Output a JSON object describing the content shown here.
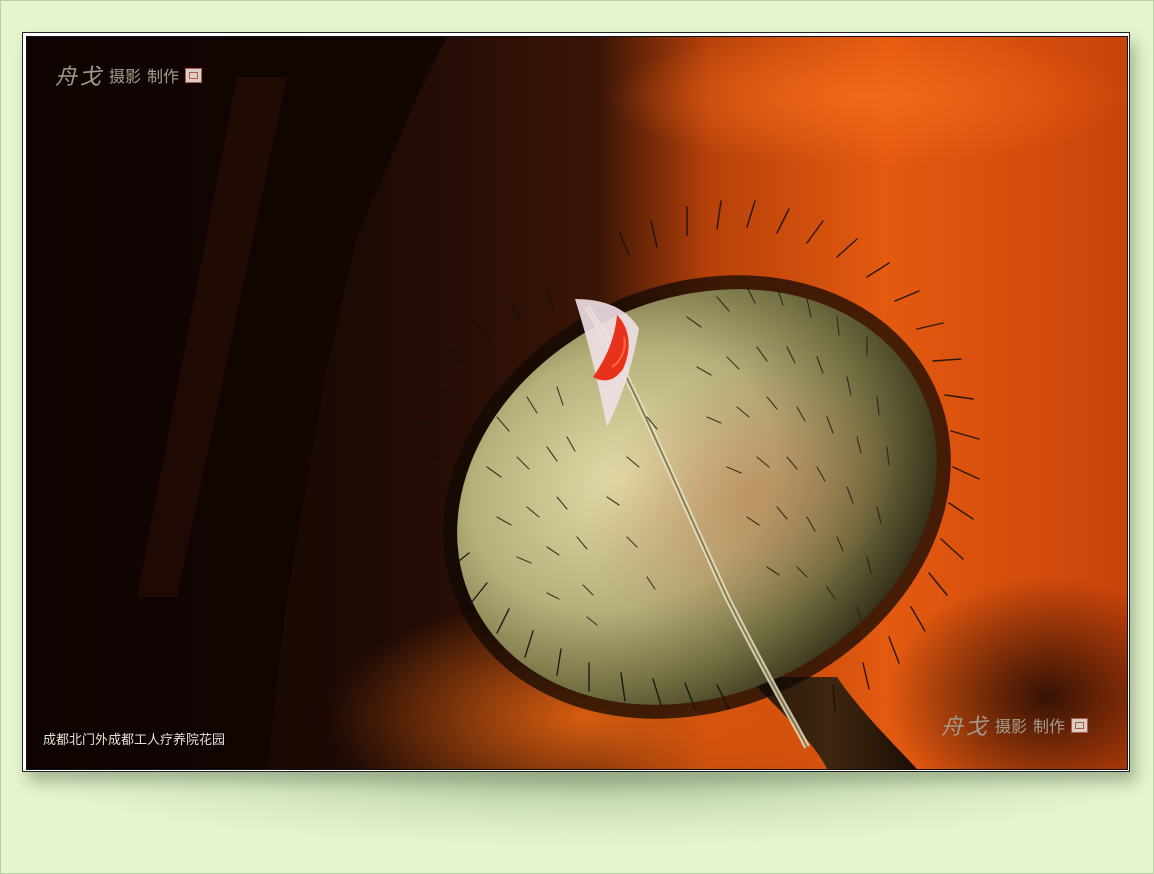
{
  "photo": {
    "caption": "成都北门外成都工人疗养院花园",
    "subject_icon": "poppy-bud-icon"
  },
  "watermark": {
    "signature": "舟戈",
    "word1": "摄影",
    "word2": "制作",
    "seal_icon": "red-seal-icon"
  },
  "colors": {
    "page_background": "#e6f5cf",
    "frame": "#ffffff",
    "background_orange": "#e2560c",
    "bud_green": "#b9b57a",
    "bud_red": "#e8321b"
  }
}
